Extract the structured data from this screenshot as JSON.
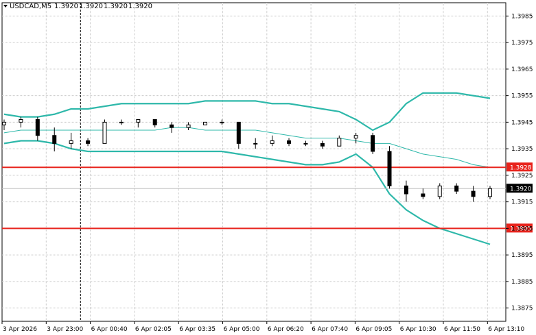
{
  "header": {
    "symbol": "USDCAD,M5",
    "open": "1.3920",
    "high": "1.3920",
    "low": "1.3920",
    "close": "1.3920"
  },
  "colors": {
    "background": "#ffffff",
    "grid": "#c8c8c8",
    "candle": "#000000",
    "bollinger": "#2eb8aa",
    "middle_band": "#2eb8aa",
    "level_line": "#e8231c",
    "price_line": "#c0c0c0",
    "current_tag": "#000000"
  },
  "chart_data": {
    "type": "candlestick",
    "title": "USDCAD,M5",
    "y_axis": {
      "min": 1.387,
      "max": 1.399,
      "ticks": [
        "1.3985",
        "1.3975",
        "1.3965",
        "1.3955",
        "1.3945",
        "1.3935",
        "1.3925",
        "1.3915",
        "1.3905",
        "1.3895",
        "1.3885",
        "1.3875"
      ]
    },
    "x_axis": {
      "ticks": [
        "3 Apr 2026",
        "3 Apr 23:00",
        "6 Apr 00:40",
        "6 Apr 02:05",
        "6 Apr 03:35",
        "6 Apr 05:00",
        "6 Apr 06:20",
        "6 Apr 07:40",
        "6 Apr 09:05",
        "6 Apr 10:30",
        "6 Apr 11:50",
        "6 Apr 13:10"
      ]
    },
    "grid": true,
    "levels": [
      {
        "label": "1.3928",
        "value": 1.3928,
        "color": "#e8231c"
      },
      {
        "label": "1.3905",
        "value": 1.3905,
        "color": "#e8231c"
      }
    ],
    "current_price": {
      "label": "1.3920",
      "value": 1.392
    },
    "crosshair_x_category": "3 Apr 23:00",
    "series": [
      {
        "name": "Bollinger Upper",
        "values": [
          1.3948,
          1.3947,
          1.3947,
          1.3948,
          1.395,
          1.395,
          1.3951,
          1.3952,
          1.3952,
          1.3952,
          1.3952,
          1.3952,
          1.3953,
          1.3953,
          1.3953,
          1.3953,
          1.3952,
          1.3952,
          1.3951,
          1.395,
          1.3949,
          1.3946,
          1.3942,
          1.3945,
          1.3952,
          1.3956,
          1.3956,
          1.3956,
          1.3955,
          1.3954
        ]
      },
      {
        "name": "Bollinger Middle",
        "values": [
          1.3941,
          1.3942,
          1.3942,
          1.3942,
          1.3942,
          1.3942,
          1.3942,
          1.3942,
          1.3942,
          1.3942,
          1.3943,
          1.3943,
          1.3942,
          1.3942,
          1.3942,
          1.3942,
          1.3941,
          1.394,
          1.3939,
          1.3939,
          1.3939,
          1.3938,
          1.3937,
          1.3937,
          1.3935,
          1.3933,
          1.3932,
          1.3931,
          1.3929,
          1.3928
        ]
      },
      {
        "name": "Bollinger Lower",
        "values": [
          1.3937,
          1.3938,
          1.3938,
          1.3937,
          1.3935,
          1.3934,
          1.3934,
          1.3934,
          1.3934,
          1.3934,
          1.3934,
          1.3934,
          1.3934,
          1.3934,
          1.3933,
          1.3932,
          1.3931,
          1.393,
          1.3929,
          1.3929,
          1.393,
          1.3933,
          1.3928,
          1.3918,
          1.3912,
          1.3908,
          1.3905,
          1.3903,
          1.3901,
          1.3899
        ]
      }
    ],
    "candles": [
      {
        "o": 1.3944,
        "h": 1.3946,
        "l": 1.3942,
        "c": 1.3945
      },
      {
        "o": 1.3945,
        "h": 1.3947,
        "l": 1.3943,
        "c": 1.3946
      },
      {
        "o": 1.3946,
        "h": 1.3947,
        "l": 1.3938,
        "c": 1.394
      },
      {
        "o": 1.394,
        "h": 1.3943,
        "l": 1.3934,
        "c": 1.3937
      },
      {
        "o": 1.3937,
        "h": 1.3941,
        "l": 1.3935,
        "c": 1.3938
      },
      {
        "o": 1.3938,
        "h": 1.3939,
        "l": 1.3936,
        "c": 1.3937
      },
      {
        "o": 1.3937,
        "h": 1.3946,
        "l": 1.3937,
        "c": 1.3945
      },
      {
        "o": 1.3945,
        "h": 1.3946,
        "l": 1.3944,
        "c": 1.3945
      },
      {
        "o": 1.3945,
        "h": 1.3946,
        "l": 1.3943,
        "c": 1.3946
      },
      {
        "o": 1.3946,
        "h": 1.3946,
        "l": 1.3943,
        "c": 1.3944
      },
      {
        "o": 1.3944,
        "h": 1.3945,
        "l": 1.3941,
        "c": 1.3943
      },
      {
        "o": 1.3943,
        "h": 1.3945,
        "l": 1.3942,
        "c": 1.3944
      },
      {
        "o": 1.3944,
        "h": 1.3945,
        "l": 1.3944,
        "c": 1.3945
      },
      {
        "o": 1.3945,
        "h": 1.3946,
        "l": 1.3944,
        "c": 1.3945
      },
      {
        "o": 1.3945,
        "h": 1.3945,
        "l": 1.3935,
        "c": 1.3937
      },
      {
        "o": 1.3937,
        "h": 1.3939,
        "l": 1.3935,
        "c": 1.3937
      },
      {
        "o": 1.3937,
        "h": 1.394,
        "l": 1.3936,
        "c": 1.3938
      },
      {
        "o": 1.3938,
        "h": 1.3939,
        "l": 1.3936,
        "c": 1.3937
      },
      {
        "o": 1.3937,
        "h": 1.3938,
        "l": 1.3936,
        "c": 1.3937
      },
      {
        "o": 1.3937,
        "h": 1.3938,
        "l": 1.3935,
        "c": 1.3936
      },
      {
        "o": 1.3936,
        "h": 1.394,
        "l": 1.3936,
        "c": 1.3939
      },
      {
        "o": 1.3939,
        "h": 1.3941,
        "l": 1.3937,
        "c": 1.394
      },
      {
        "o": 1.394,
        "h": 1.3941,
        "l": 1.3933,
        "c": 1.3934
      },
      {
        "o": 1.3934,
        "h": 1.3936,
        "l": 1.392,
        "c": 1.3921
      },
      {
        "o": 1.3921,
        "h": 1.3923,
        "l": 1.3915,
        "c": 1.3918
      },
      {
        "o": 1.3918,
        "h": 1.392,
        "l": 1.3916,
        "c": 1.3917
      },
      {
        "o": 1.3917,
        "h": 1.3922,
        "l": 1.3916,
        "c": 1.3921
      },
      {
        "o": 1.3921,
        "h": 1.3922,
        "l": 1.3918,
        "c": 1.3919
      },
      {
        "o": 1.3919,
        "h": 1.3921,
        "l": 1.3915,
        "c": 1.3917
      },
      {
        "o": 1.3917,
        "h": 1.3921,
        "l": 1.3916,
        "c": 1.392
      }
    ]
  }
}
